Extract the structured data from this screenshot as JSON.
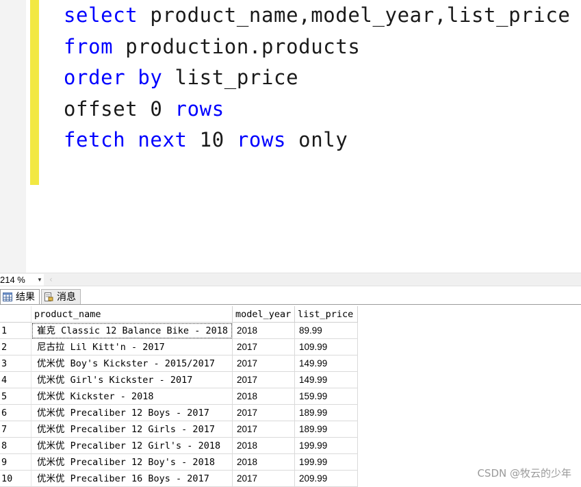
{
  "editor": {
    "lines": [
      [
        {
          "t": "select",
          "kw": true
        },
        {
          "t": " product_name,model_year,list_price",
          "kw": false
        }
      ],
      [
        {
          "t": "from",
          "kw": true
        },
        {
          "t": " production.products",
          "kw": false
        }
      ],
      [
        {
          "t": "order by",
          "kw": true
        },
        {
          "t": " list_price",
          "kw": false
        }
      ],
      [
        {
          "t": "offset 0 ",
          "kw": false
        },
        {
          "t": "rows",
          "kw": true
        }
      ],
      [
        {
          "t": "fetch next",
          "kw": true
        },
        {
          "t": " 10 ",
          "kw": false
        },
        {
          "t": "rows",
          "kw": true
        },
        {
          "t": " only",
          "kw": false
        }
      ]
    ]
  },
  "zoom": {
    "value": "214 %",
    "arrow_icon": "dropdown-arrow-icon"
  },
  "tabs": {
    "results_label": "结果",
    "messages_label": "消息"
  },
  "grid": {
    "columns": [
      "product_name",
      "model_year",
      "list_price"
    ],
    "rows": [
      {
        "n": "1",
        "name": "崔克 Classic 12 Balance Bike - 2018",
        "year": "2018",
        "price": "89.99"
      },
      {
        "n": "2",
        "name": "尼古拉 Lil Kitt'n - 2017",
        "year": "2017",
        "price": "109.99"
      },
      {
        "n": "3",
        "name": "优米优 Boy's Kickster - 2015/2017",
        "year": "2017",
        "price": "149.99"
      },
      {
        "n": "4",
        "name": "优米优 Girl's Kickster - 2017",
        "year": "2017",
        "price": "149.99"
      },
      {
        "n": "5",
        "name": "优米优 Kickster - 2018",
        "year": "2018",
        "price": "159.99"
      },
      {
        "n": "6",
        "name": "优米优 Precaliber 12 Boys - 2017",
        "year": "2017",
        "price": "189.99"
      },
      {
        "n": "7",
        "name": "优米优 Precaliber 12 Girls - 2017",
        "year": "2017",
        "price": "189.99"
      },
      {
        "n": "8",
        "name": "优米优 Precaliber 12 Girl's - 2018",
        "year": "2018",
        "price": "199.99"
      },
      {
        "n": "9",
        "name": "优米优 Precaliber 12 Boy's - 2018",
        "year": "2018",
        "price": "199.99"
      },
      {
        "n": "10",
        "name": "优米优 Precaliber 16 Boys - 2017",
        "year": "2017",
        "price": "209.99"
      }
    ]
  },
  "watermark": "CSDN @牧云的少年",
  "colors": {
    "keyword": "#0000ff",
    "change_bar": "#f2e843"
  }
}
